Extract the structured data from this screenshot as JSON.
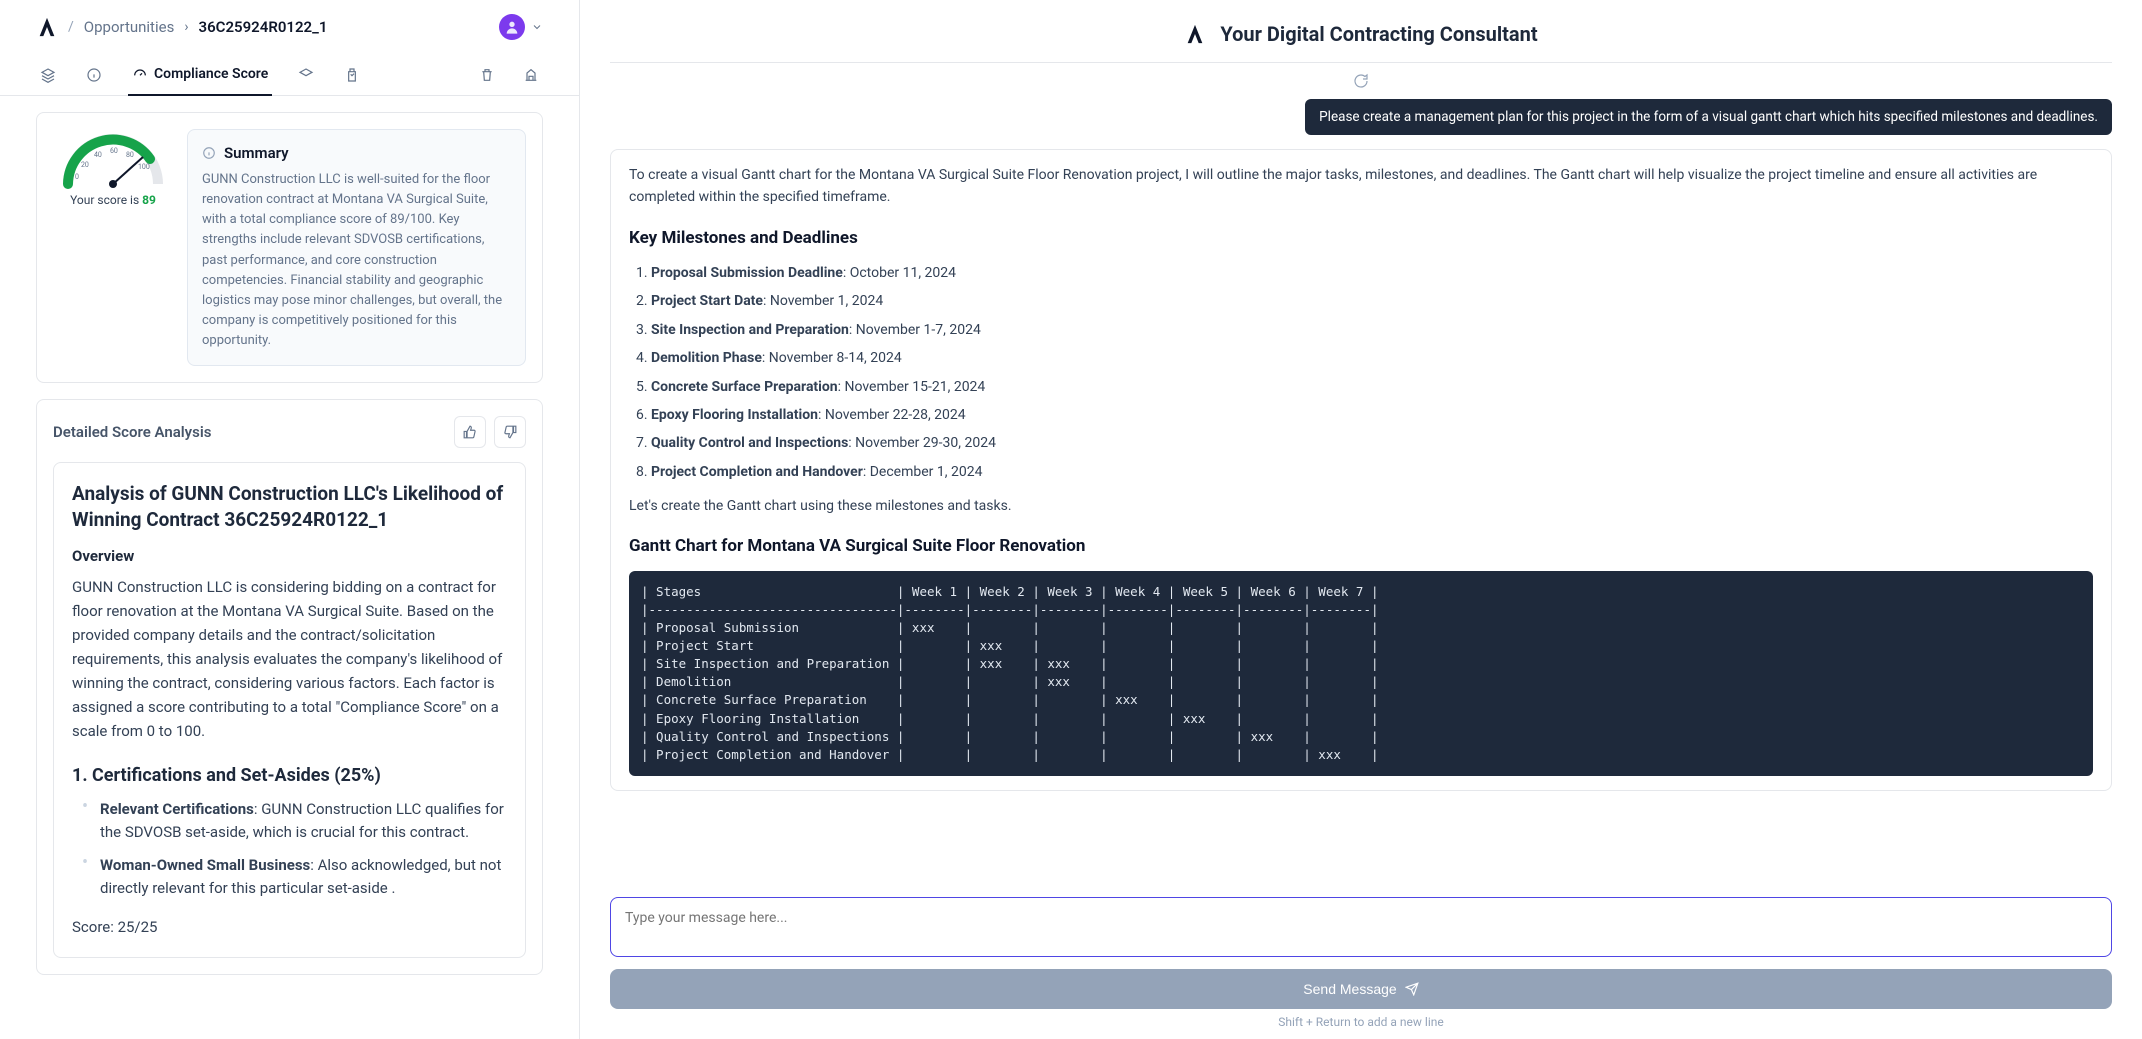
{
  "header": {
    "crumb1": "Opportunities",
    "crumb_id": "36C25924R0122_1"
  },
  "tabs": {
    "active_label": "Compliance Score"
  },
  "score": {
    "label_prefix": "Your score is ",
    "value": "89"
  },
  "summary": {
    "title": "Summary",
    "text": "GUNN Construction LLC is well-suited for the floor renovation contract at Montana VA Surgical Suite, with a total compliance score of 89/100. Key strengths include relevant SDVOSB certifications, past performance, and core construction competencies. Financial stability and geographic logistics may pose minor challenges, but overall, the company is competitively positioned for this opportunity."
  },
  "dsa": {
    "title": "Detailed Score Analysis"
  },
  "analysis": {
    "heading": "Analysis of GUNN Construction LLC's Likelihood of Winning Contract 36C25924R0122_1",
    "overview_h": "Overview",
    "overview_p": "GUNN Construction LLC is considering bidding on a contract for floor renovation at the Montana VA Surgical Suite. Based on the provided company details and the contract/solicitation requirements, this analysis evaluates the company's likelihood of winning the contract, considering various factors. Each factor is assigned a score contributing to a total \"Compliance Score\" on a scale from 0 to 100.",
    "sec1_h": "1. Certifications and Set-Asides (25%)",
    "li1_b": "Relevant Certifications",
    "li1_t": ": GUNN Construction LLC qualifies for the SDVOSB set-aside, which is crucial for this contract.",
    "li2_b": "Woman-Owned Small Business",
    "li2_t": ": Also acknowledged, but not directly relevant for this particular set-aside .",
    "score_line": "Score: 25/25"
  },
  "right": {
    "title": "Your Digital Contracting Consultant"
  },
  "chat": {
    "user_msg": "Please create a management plan for this project in the form of a visual gantt chart which hits specified milestones and deadlines.",
    "intro": "To create a visual Gantt chart for the Montana VA Surgical Suite Floor Renovation project, I will outline the major tasks, milestones, and deadlines. The Gantt chart will help visualize the project timeline and ensure all activities are completed within the specified timeframe.",
    "milestones_h": "Key Milestones and Deadlines",
    "milestones": [
      {
        "b": "Proposal Submission Deadline",
        "t": ": October 11, 2024"
      },
      {
        "b": "Project Start Date",
        "t": ": November 1, 2024"
      },
      {
        "b": "Site Inspection and Preparation",
        "t": ": November 1-7, 2024"
      },
      {
        "b": "Demolition Phase",
        "t": ": November 8-14, 2024"
      },
      {
        "b": "Concrete Surface Preparation",
        "t": ": November 15-21, 2024"
      },
      {
        "b": "Epoxy Flooring Installation",
        "t": ": November 22-28, 2024"
      },
      {
        "b": "Quality Control and Inspections",
        "t": ": November 29-30, 2024"
      },
      {
        "b": "Project Completion and Handover",
        "t": ": December 1, 2024"
      }
    ],
    "create_line": "Let's create the Gantt chart using these milestones and tasks.",
    "gantt_h": "Gantt Chart for Montana VA Surgical Suite Floor Renovation",
    "gantt_text": "| Stages                          | Week 1 | Week 2 | Week 3 | Week 4 | Week 5 | Week 6 | Week 7 |\n|---------------------------------|--------|--------|--------|--------|--------|--------|--------|\n| Proposal Submission             | xxx    |        |        |        |        |        |        |\n| Project Start                   |        | xxx    |        |        |        |        |        |\n| Site Inspection and Preparation |        | xxx    | xxx    |        |        |        |        |\n| Demolition                      |        |        | xxx    |        |        |        |        |\n| Concrete Surface Preparation    |        |        |        | xxx    |        |        |        |\n| Epoxy Flooring Installation     |        |        |        |        | xxx    |        |        |\n| Quality Control and Inspections |        |        |        |        |        | xxx    |        |\n| Project Completion and Handover |        |        |        |        |        |        | xxx    |"
  },
  "composer": {
    "placeholder": "Type your message here...",
    "send": "Send Message",
    "hint": "Shift + Return to add a new line"
  }
}
